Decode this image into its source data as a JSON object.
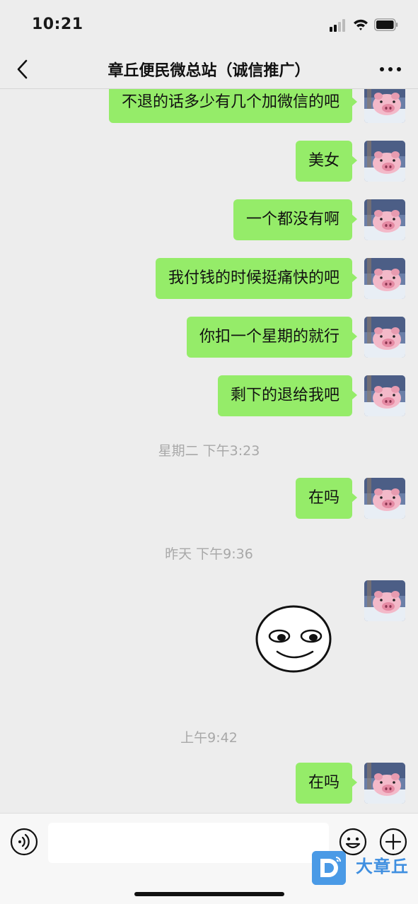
{
  "status_bar": {
    "time": "10:21"
  },
  "nav": {
    "title": "章丘便民微总站（诚信推广）"
  },
  "messages": [
    {
      "text": "不退的话多少有几个加微信的吧"
    },
    {
      "text": "美女"
    },
    {
      "text": "一个都没有啊"
    },
    {
      "text": "我付钱的时候挺痛快的吧"
    },
    {
      "text": "你扣一个星期的就行"
    },
    {
      "text": "剩下的退给我吧"
    },
    {
      "text": "在吗"
    },
    {
      "text": "在吗"
    }
  ],
  "timestamps": [
    {
      "text": "星期二 下午3:23"
    },
    {
      "text": "昨天 下午9:36"
    },
    {
      "text": "上午9:42"
    }
  ],
  "sticker": {
    "icon": "smiling-face-sticker"
  },
  "input_bar": {
    "voice_icon": "voice-icon",
    "emoji_icon": "emoji-icon",
    "plus_icon": "plus-icon",
    "text_value": ""
  },
  "watermark": {
    "text": "大章丘"
  },
  "colors": {
    "bubble": "#95ec69",
    "background": "#ededed",
    "watermark": "#3f8fe0"
  }
}
